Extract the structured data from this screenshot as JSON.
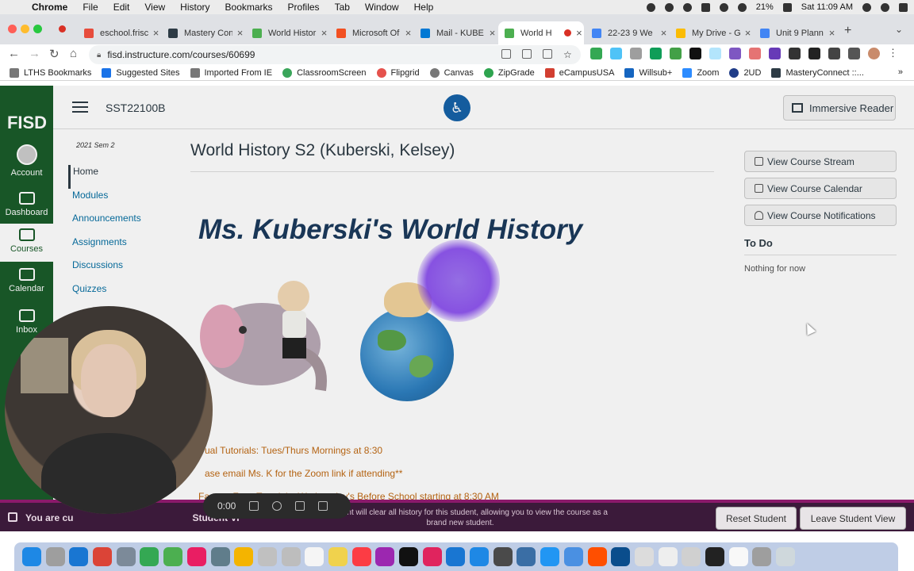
{
  "menubar": {
    "app": "Chrome",
    "items": [
      "File",
      "Edit",
      "View",
      "History",
      "Bookmarks",
      "Profiles",
      "Tab",
      "Window",
      "Help"
    ],
    "battery": "21%",
    "clock": "Sat 11:09 AM"
  },
  "tabs": [
    {
      "label": "eschool.frisco",
      "fav_color": "#e74c3c"
    },
    {
      "label": "Mastery Conn",
      "fav_color": "#2d3b45"
    },
    {
      "label": "World Histor",
      "fav_color": "#4caf50"
    },
    {
      "label": "Microsoft Of",
      "fav_color": "#f25022"
    },
    {
      "label": "Mail - KUBE",
      "fav_color": "#0078d4"
    },
    {
      "label": "World H",
      "fav_color": "#4caf50",
      "active": true
    },
    {
      "label": "22-23 9 We",
      "fav_color": "#4285f4"
    },
    {
      "label": "My Drive - G",
      "fav_color": "#fbbc04"
    },
    {
      "label": "Unit 9 Plann",
      "fav_color": "#4285f4"
    }
  ],
  "omnibox": {
    "url": "fisd.instructure.com/courses/60699"
  },
  "bookmarks": [
    {
      "label": "LTHS Bookmarks",
      "color": "#6b6b6b"
    },
    {
      "label": "Suggested Sites",
      "color": "#1a73e8"
    },
    {
      "label": "Imported From IE",
      "color": "#6b6b6b"
    },
    {
      "label": "ClassroomScreen",
      "color": "#3aa55a"
    },
    {
      "label": "Flipgrid",
      "color": "#e5524d"
    },
    {
      "label": "Canvas",
      "color": "#6b6b6b"
    },
    {
      "label": "ZipGrade",
      "color": "#2ea44f"
    },
    {
      "label": "eCampusUSA",
      "color": "#d23f31"
    },
    {
      "label": "Willsub+",
      "color": "#1565c0"
    },
    {
      "label": "Zoom",
      "color": "#2d8cff"
    },
    {
      "label": "2UD",
      "color": "#1f3c88"
    },
    {
      "label": "MasteryConnect ::...",
      "color": "#2d3b45"
    }
  ],
  "globalnav": {
    "logo": "FISD",
    "items": [
      "Account",
      "Dashboard",
      "Courses",
      "Calendar",
      "Inbox"
    ]
  },
  "header": {
    "course_code": "SST22100B",
    "immersive": "Immersive Reader"
  },
  "coursenav": {
    "term": "2021 Sem 2",
    "items": [
      "Home",
      "Modules",
      "Announcements",
      "Assignments",
      "Discussions",
      "Quizzes"
    ]
  },
  "main": {
    "title": "World History S2 (Kuberski, Kelsey)",
    "banner": "Ms. Kuberski's World History",
    "tutorials": [
      "ual Tutorials: Tues/Thurs Mornings at 8:30",
      "ase email Ms. K for the Zoom link if attending**",
      "Face to Face Tutorials: Wednesday's Before School starting at 8:30 AM"
    ]
  },
  "rightbar": {
    "buttons": [
      "View Course Stream",
      "View Course Calendar",
      "View Course Notifications"
    ],
    "todo_heading": "To Do",
    "todo_text": "Nothing for now"
  },
  "studentbar": {
    "text": "You are cu",
    "text2": "Student Vi",
    "desc": "test student will clear all history for this student, allowing you to view the course as a brand new student.",
    "reset": "Reset Student",
    "leave": "Leave Student View"
  },
  "video": {
    "time": "0:00"
  },
  "dock_colors": [
    "#1e88e5",
    "#9e9e9e",
    "#1976d2",
    "#db4437",
    "#7c8a99",
    "#34a853",
    "#4caf50",
    "#e91e63",
    "#607d8b",
    "#f4b400",
    "#c0c0c0",
    "#bdbdbd",
    "#f5f5f5",
    "#f0d24d",
    "#fc3c44",
    "#9c27b0",
    "#111111",
    "#e0245e",
    "#1976d2",
    "#1e88e5",
    "#4a4a4a",
    "#3a6ea5",
    "#2196f3",
    "#4a90e2",
    "#ff4f00",
    "#0a4d8c",
    "#dcdcdc",
    "#eeeeee",
    "#d0d0d0",
    "#222222",
    "#f8f8f8",
    "#9e9e9e",
    "#cfd8dc"
  ]
}
